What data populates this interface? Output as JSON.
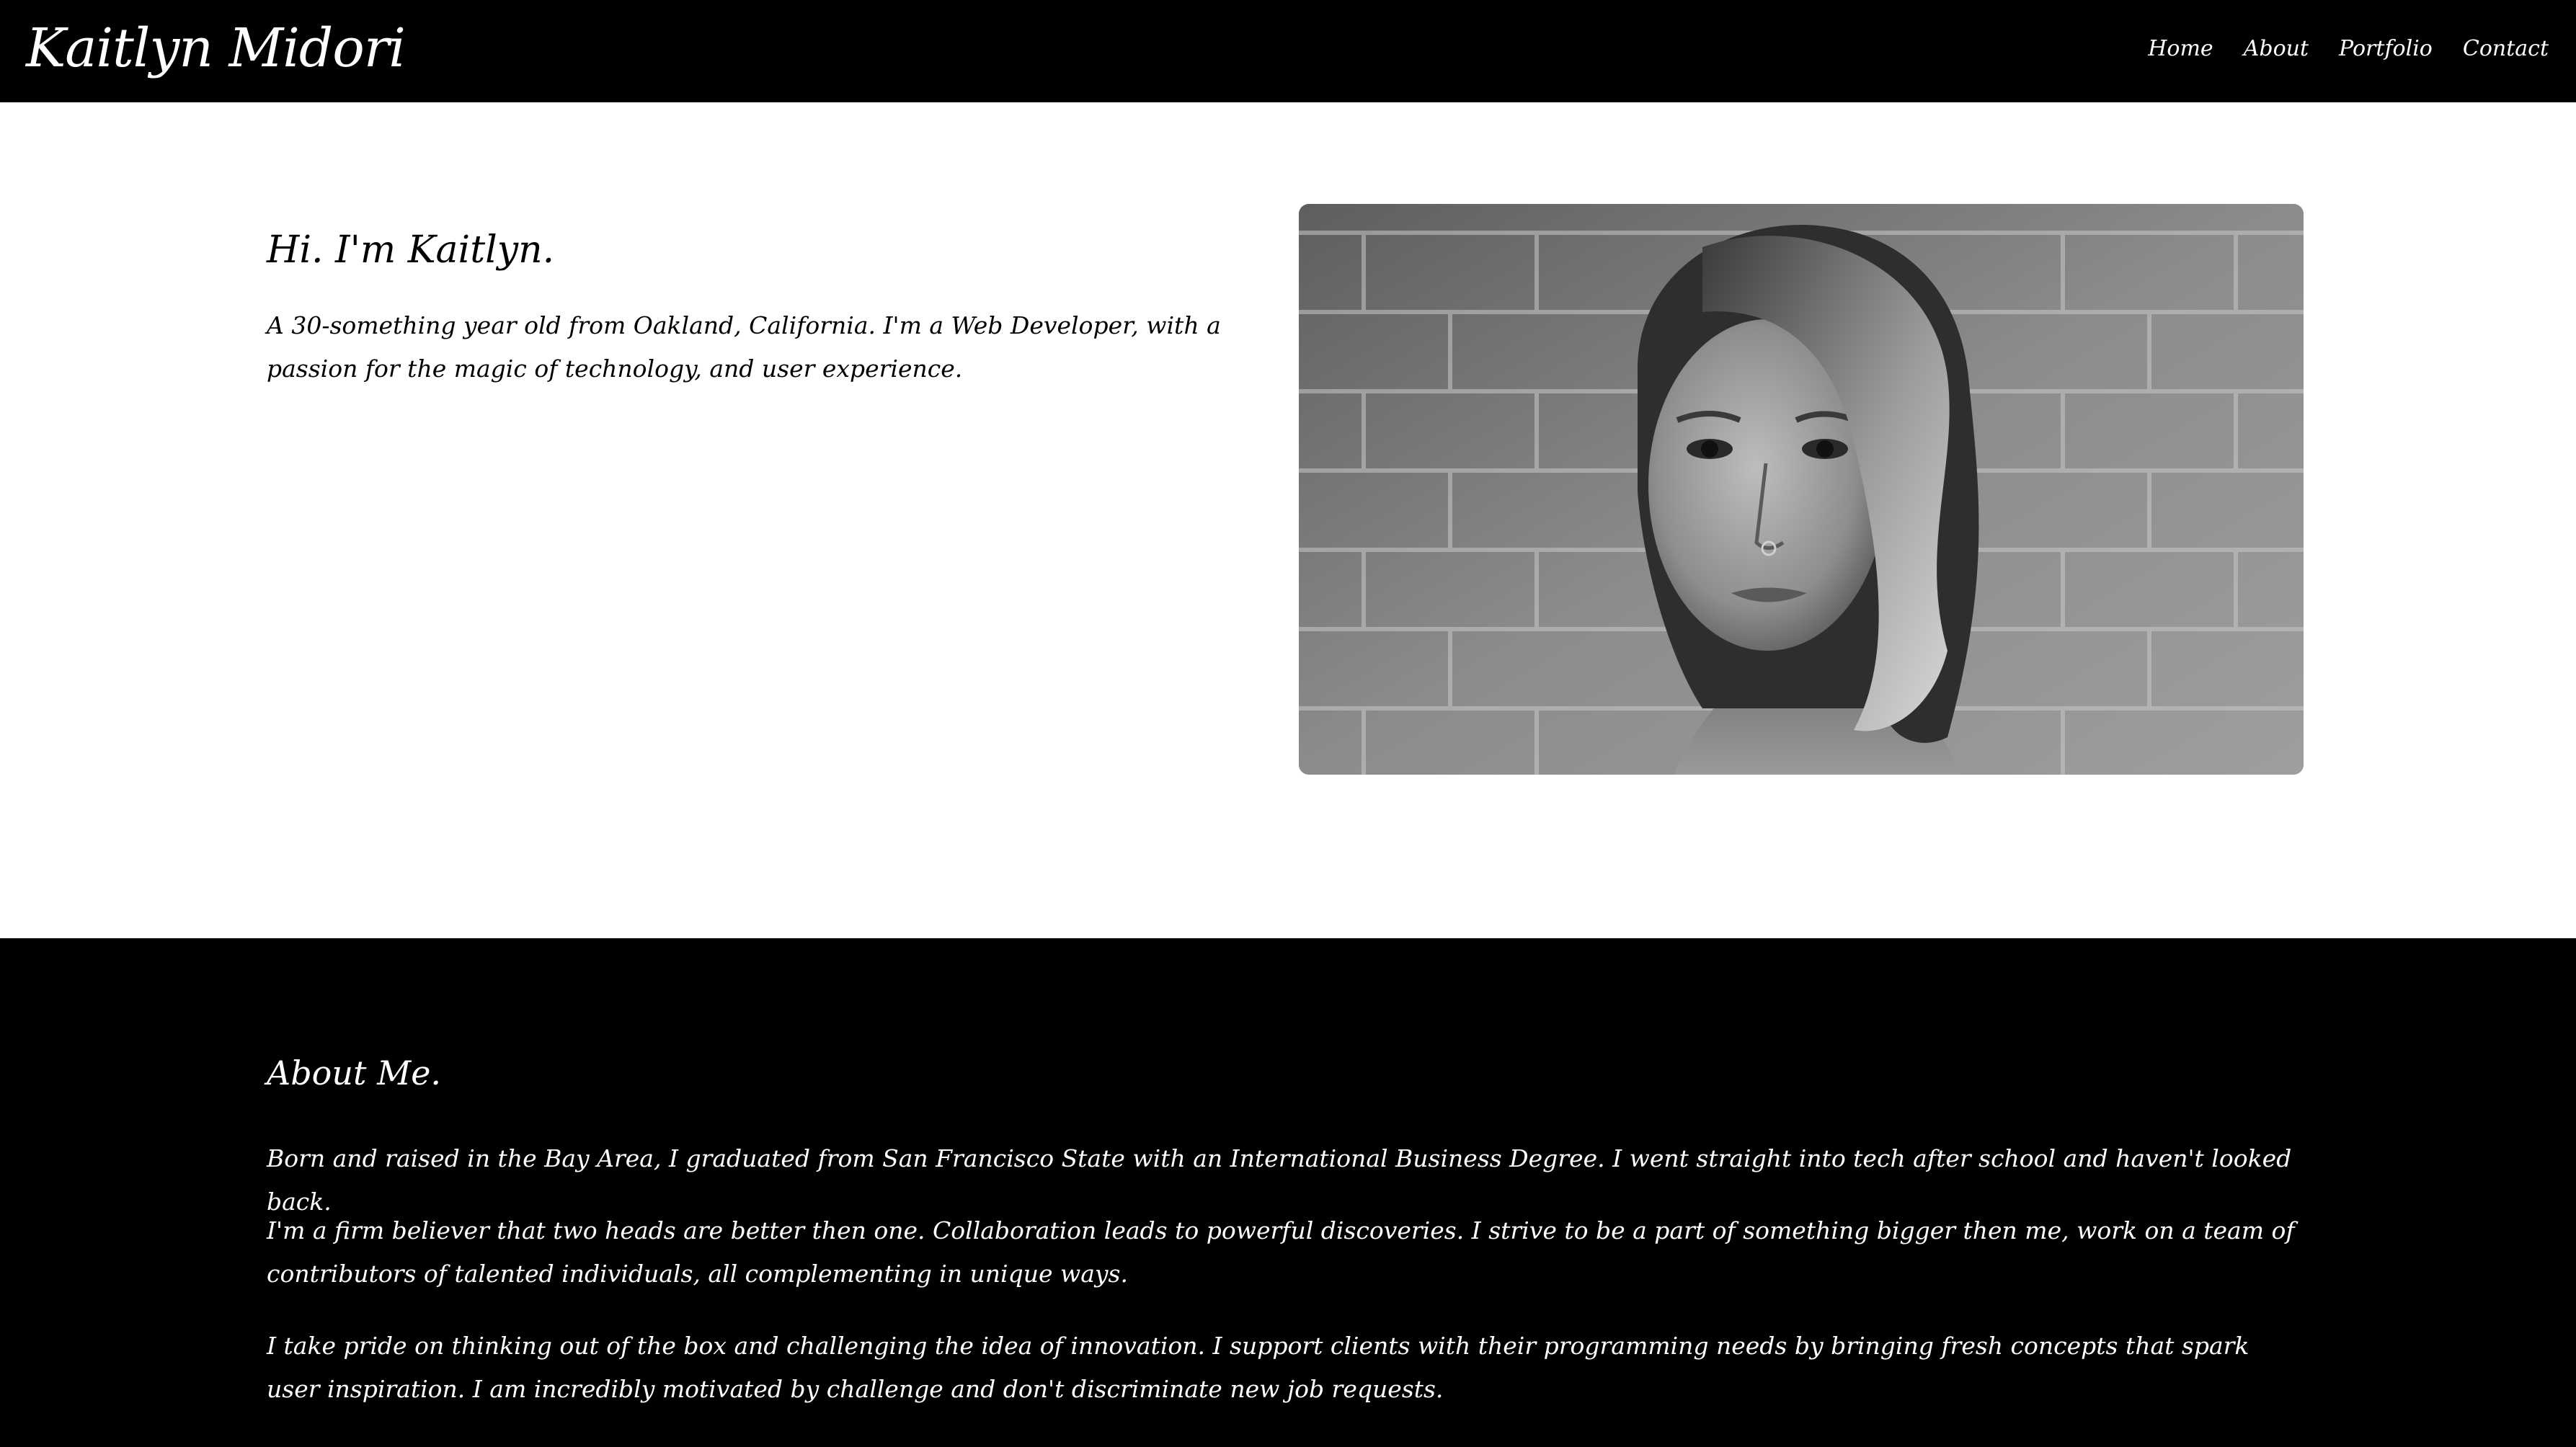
{
  "header": {
    "brand": "Kaitlyn Midori",
    "nav": [
      "Home",
      "About",
      "Portfolio",
      "Contact"
    ]
  },
  "hero": {
    "title": "Hi. I'm Kaitlyn.",
    "intro": "A 30-something year old from Oakland, California. I'm a Web Developer, with a passion for the magic of technology, and user experience."
  },
  "about": {
    "title": "About Me.",
    "paragraphs": [
      "Born and raised in the Bay Area, I graduated from San Francisco State with an International Business Degree. I went straight into tech after school and haven't looked back.",
      "I'm a firm believer that two heads are better then one. Collaboration leads to powerful discoveries. I strive to be a part of something bigger then me, work on a team of contributors of talented individuals, all complementing in unique ways.",
      "I take pride on thinking out of the box and challenging the idea of innovation. I support clients with their programming needs by bringing fresh concepts that spark user inspiration. I am incredibly motivated by challenge and don't discriminate new job requests."
    ]
  },
  "colors": {
    "header_bg": "#000000",
    "hero_bg": "#ffffff",
    "about_bg": "#000000",
    "text_light": "#ffffff",
    "text_dark": "#000000"
  }
}
